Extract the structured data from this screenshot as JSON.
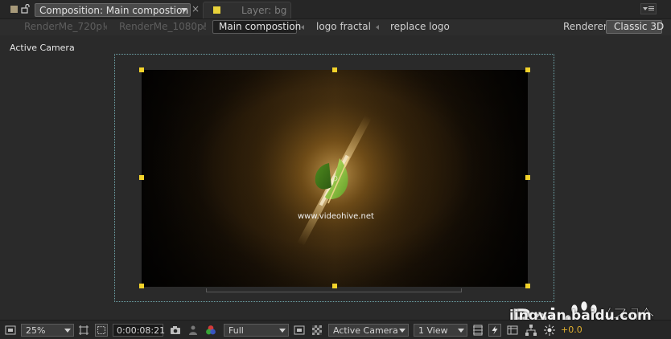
{
  "tabs": {
    "composition": {
      "label": "Composition: Main compostion",
      "swatch_color": "#a89a7a"
    },
    "layer": {
      "label": "Layer: bg",
      "swatch_color": "#e8d23a"
    }
  },
  "breadcrumbs": {
    "items": [
      "RenderMe_720p!",
      "RenderMe_1080p!",
      "Main compostion",
      "logo fractal",
      "replace logo"
    ],
    "active_index": 2
  },
  "renderer": {
    "label": "Renderer:",
    "value": "Classic 3D"
  },
  "viewer": {
    "view_label": "Active Camera",
    "comp_text": "www.videohive.net"
  },
  "toolbar": {
    "magnification": "25%",
    "timecode": "0:00:08:21",
    "resolution": "Full",
    "view_mode": "Active Camera",
    "view_layout": "1 View",
    "exposure": "+0.0",
    "icons": [
      "always-preview-icon",
      "fit-icon",
      "grid-icon",
      "mask-icon",
      "snapshot-icon",
      "show-snapshot-icon",
      "channel-icon",
      "region-icon",
      "transparency-icon",
      "draft-3d-icon",
      "fast-preview-icon",
      "timeline-icon",
      "flowchart-icon",
      "reset-exposure-icon"
    ]
  },
  "watermark": {
    "logo": "Bai百度经验",
    "url": "jingyan.baidu.com"
  },
  "colors": {
    "accent_yellow": "#f2d22a",
    "exposure_orange": "#e0b030",
    "safe_guide": "#6fa5aa"
  }
}
